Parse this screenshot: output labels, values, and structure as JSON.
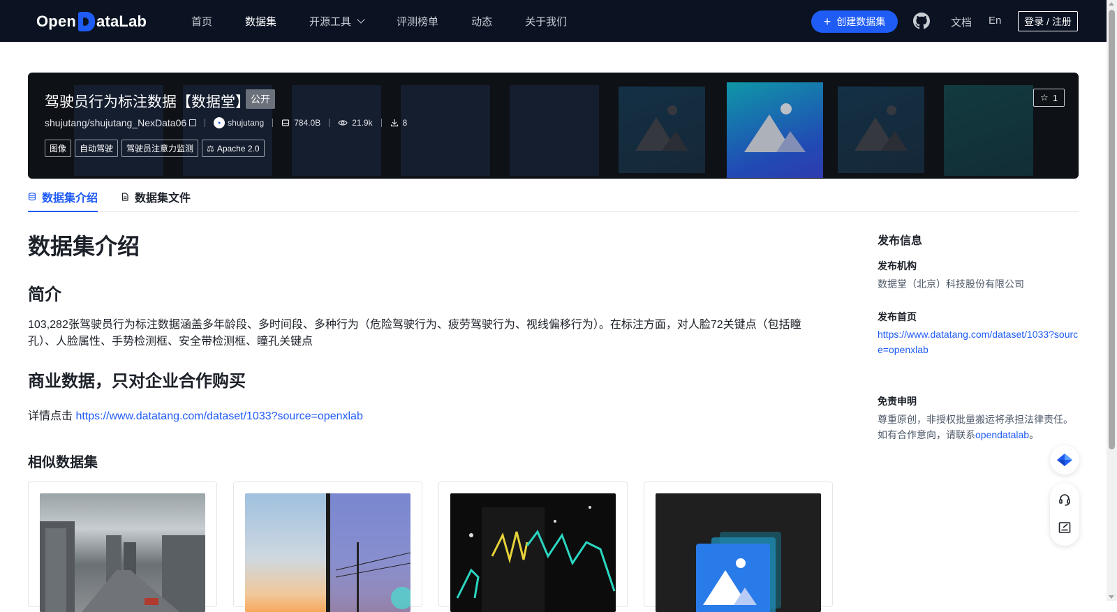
{
  "nav": {
    "logo_prefix": "Open",
    "logo_suffix": "ataLab",
    "items": [
      "首页",
      "数据集",
      "开源工具",
      "评测榜单",
      "动态",
      "关于我们"
    ],
    "create_label": "创建数据集",
    "doc_label": "文档",
    "lang_label": "En",
    "login_label": "登录 / 注册"
  },
  "banner": {
    "title": "驾驶员行为标注数据【数据堂】",
    "visibility": "公开",
    "repo": "shujutang/shujutang_NexData06",
    "author": "shujutang",
    "size": "784.0B",
    "views": "21.9k",
    "downloads": "8",
    "tags": [
      "图像",
      "自动驾驶",
      "驾驶员注意力监测"
    ],
    "license": "Apache 2.0",
    "stars": "1"
  },
  "tabs": {
    "intro": "数据集介绍",
    "files": "数据集文件"
  },
  "content": {
    "h1": "数据集介绍",
    "section1": "简介",
    "description": "103,282张驾驶员行为标注数据涵盖多年龄段、多时间段、多种行为（危险驾驶行为、疲劳驾驶行为、视线偏移行为）。在标注方面，对人脸72关键点（包括瞳孔）、人脸属性、手势检测框、安全带检测框、瞳孔关键点",
    "section2": "商业数据，只对企业合作购买",
    "detail_prefix": "详情点击 ",
    "detail_link": "https://www.datatang.com/dataset/1033?source=openxlab",
    "similar_title": "相似数据集"
  },
  "sidebar": {
    "title": "发布信息",
    "org_label": "发布机构",
    "org_value": "数据堂（北京）科技股份有限公司",
    "home_label": "发布首页",
    "home_link": "https://www.datatang.com/dataset/1033?source=openxlab",
    "disclaimer_label": "免责申明",
    "disclaimer_line1": "尊重原创，非授权批量搬运将承担法律责任。",
    "disclaimer_line2_prefix": "如有合作意向，请联系",
    "disclaimer_link": "opendatalab",
    "disclaimer_line2_suffix": "。"
  },
  "colors": {
    "accent": "#1f5cf5",
    "nav_bg": "#0b1222",
    "banner_bg": "#0e1116"
  }
}
